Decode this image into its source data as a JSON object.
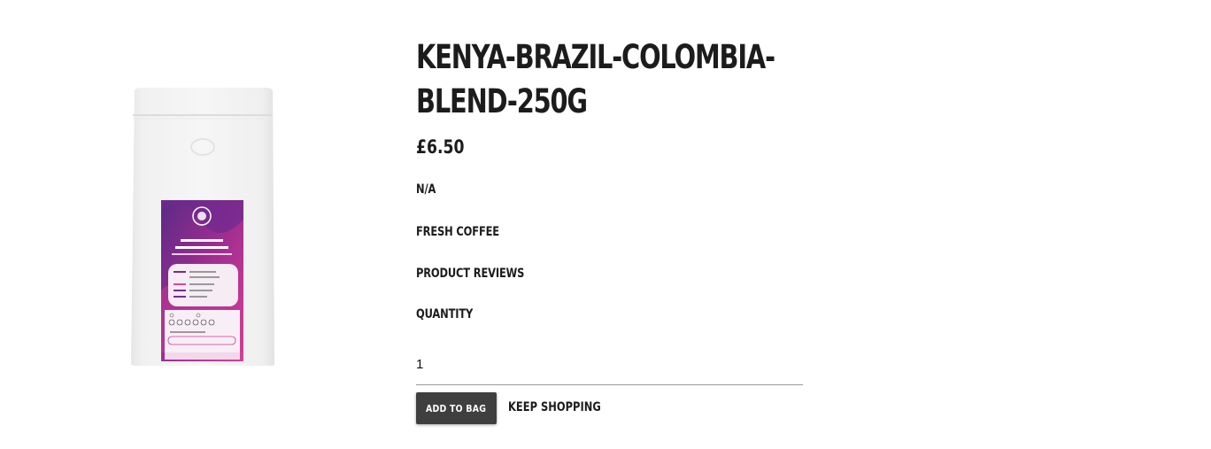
{
  "product": {
    "title": "KENYA-BRAZIL-COLOMBIA-BLEND-250G",
    "price": "£6.50",
    "subtitle": "N/A",
    "category": "FRESH COFFEE",
    "reviews_label": "PRODUCT REVIEWS",
    "quantity_label": "QUANTITY",
    "quantity_value": "1"
  },
  "actions": {
    "add_to_bag": "ADD TO BAG",
    "keep_shopping": "KEEP SHOPPING"
  },
  "colors": {
    "text": "#1c1c1c",
    "button_bg": "#3f3f3f",
    "button_text": "#ffffff",
    "label_purple": "#7b2a8c",
    "label_pink": "#e0459a"
  },
  "image": {
    "semantic": "coffee-bag-product-image"
  }
}
